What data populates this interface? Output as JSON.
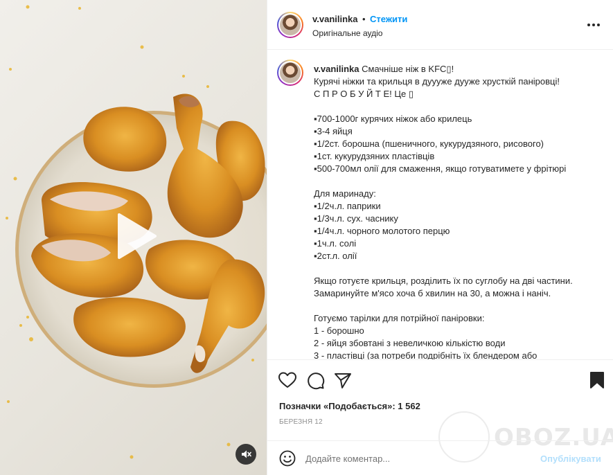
{
  "header": {
    "username": "v.vanilinka",
    "separator": "•",
    "follow_label": "Стежити",
    "audio_label": "Оригінальне аудіо"
  },
  "caption": {
    "username": "v.vanilinka",
    "first_line": "Смачніше ніж в KFC▯!",
    "lines": [
      "Курячі ніжки та крильця в дуууже дууже хрусткій паніровці!",
      "С П Р О Б У Й Т Е! Це ▯",
      "",
      "▪︎700-1000г курячих ніжок або крилець",
      "▪︎3-4 яйця",
      "▪︎1/2ст. борошна (пшеничного, кукурудзяного, рисового)",
      "▪︎1ст. кукурудзяних пластівців",
      "▪︎500-700мл олії для смаження, якщо готуватимете у фрітюрі",
      "",
      "Для маринаду:",
      "▪︎1/2ч.л. паприки",
      "▪︎1/3ч.л. сух. часнику",
      "▪︎1/4ч.л. чорного молотого перцю",
      "▪︎1ч.л. солі",
      "▪︎2ст.л. олії",
      "",
      "Якщо готуєте крильця, розділить їх по суглобу на дві частини.",
      "Замаринуйте м'ясо хоча б хвилин на 30, а можна і наніч.",
      "",
      "Готуємо тарілки для потрійної паніровки:",
      "1 - борошно",
      "2 - яйця збовтані з невеличкою кількістю води",
      "3 - пластівці (за потреби подрібніть їх блендером або"
    ]
  },
  "actions": {
    "like_icon": "heart-icon",
    "comment_icon": "comment-icon",
    "share_icon": "share-icon",
    "save_icon": "bookmark-icon"
  },
  "likes_text": "Позначки «Подобається»: 1 562",
  "date_text": "Березня 12",
  "comment": {
    "placeholder": "Додайте коментар...",
    "post_label": "Опублікувати"
  },
  "watermark": {
    "text": "OBOZ.UA"
  },
  "colors": {
    "accent": "#0095f6",
    "post_disabled": "#b2dffc",
    "text": "#262626",
    "muted": "#8e8e8e"
  }
}
